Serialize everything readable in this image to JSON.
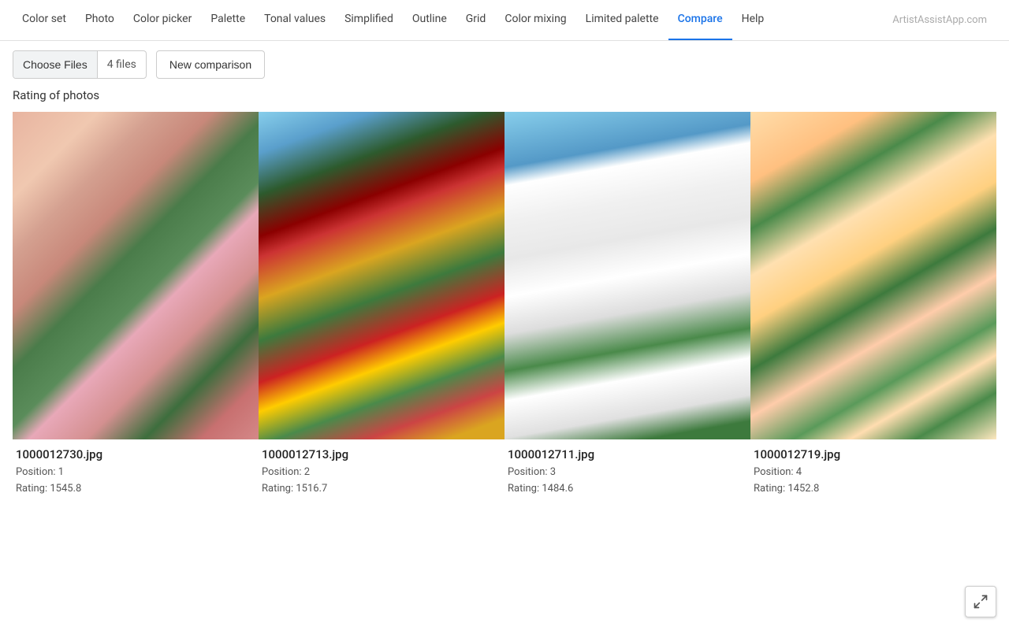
{
  "nav": {
    "items": [
      {
        "label": "Color set",
        "id": "color-set",
        "active": false
      },
      {
        "label": "Photo",
        "id": "photo",
        "active": false
      },
      {
        "label": "Color picker",
        "id": "color-picker",
        "active": false
      },
      {
        "label": "Palette",
        "id": "palette",
        "active": false
      },
      {
        "label": "Tonal values",
        "id": "tonal-values",
        "active": false
      },
      {
        "label": "Simplified",
        "id": "simplified",
        "active": false
      },
      {
        "label": "Outline",
        "id": "outline",
        "active": false
      },
      {
        "label": "Grid",
        "id": "grid",
        "active": false
      },
      {
        "label": "Color mixing",
        "id": "color-mixing",
        "active": false
      },
      {
        "label": "Limited palette",
        "id": "limited-palette",
        "active": false
      },
      {
        "label": "Compare",
        "id": "compare",
        "active": true
      },
      {
        "label": "Help",
        "id": "help",
        "active": false
      }
    ],
    "brand": "ArtistAssistApp.com"
  },
  "toolbar": {
    "choose_files_label": "Choose Files",
    "file_count": "4 files",
    "new_comparison_label": "New comparison"
  },
  "section_heading": "Rating of photos",
  "photos": [
    {
      "filename": "1000012730.jpg",
      "position_label": "Position: 1",
      "rating_label": "Rating: 1545.8",
      "img_class": "img-1"
    },
    {
      "filename": "1000012713.jpg",
      "position_label": "Position: 2",
      "rating_label": "Rating: 1516.7",
      "img_class": "img-2"
    },
    {
      "filename": "1000012711.jpg",
      "position_label": "Position: 3",
      "rating_label": "Rating: 1484.6",
      "img_class": "img-3"
    },
    {
      "filename": "1000012719.jpg",
      "position_label": "Position: 4",
      "rating_label": "Rating: 1452.8",
      "img_class": "img-4"
    }
  ],
  "expand_button": {
    "tooltip": "Expand"
  }
}
